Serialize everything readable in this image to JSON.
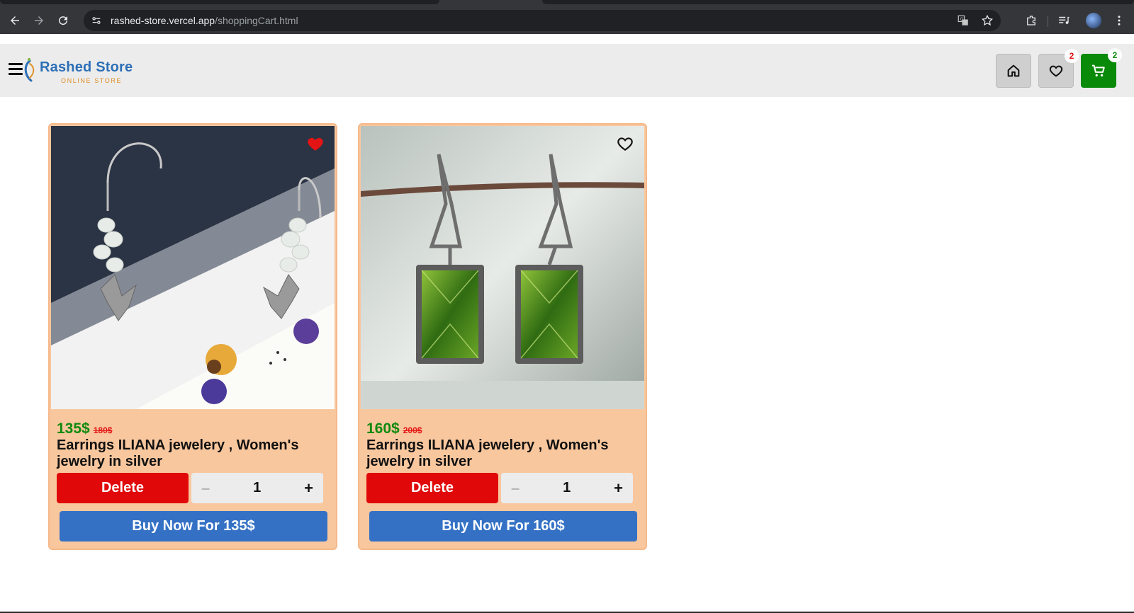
{
  "browser": {
    "url_host": "rashed-store.vercel.app",
    "url_path": "/shoppingCart.html",
    "icons": [
      "back-icon",
      "forward-icon",
      "reload-icon",
      "site-info-icon",
      "translate-icon",
      "star-icon",
      "extensions-icon",
      "media-controls-icon",
      "profile-avatar",
      "kebab-menu-icon"
    ]
  },
  "header": {
    "logo_title": "Rashed Store",
    "logo_subtitle": "ONLINE STORE",
    "wishlist_count": "2",
    "cart_count": "2",
    "colors": {
      "cart_button": "#098a09",
      "badge_wishlist": "#e31414",
      "badge_cart": "#098a09"
    }
  },
  "cart": {
    "items": [
      {
        "price": "135$",
        "old_price": "180$",
        "title": "Earrings ILIANA jewelery , Women's jewelry in silver",
        "delete_label": "Delete",
        "qty_minus": "–",
        "quantity": "1",
        "qty_plus": "+",
        "buy_label": "Buy Now For 135$",
        "favorited": true
      },
      {
        "price": "160$",
        "old_price": "200$",
        "title": "Earrings ILIANA jewelery , Women's jewelry in silver",
        "delete_label": "Delete",
        "qty_minus": "–",
        "quantity": "1",
        "qty_plus": "+",
        "buy_label": "Buy Now For 160$",
        "favorited": false
      }
    ]
  },
  "colors": {
    "card_bg": "#f9c79e",
    "price_green": "#0f8a0f",
    "old_price_red": "#e31414",
    "delete_red": "#e00808",
    "buy_blue": "#3471c5"
  }
}
